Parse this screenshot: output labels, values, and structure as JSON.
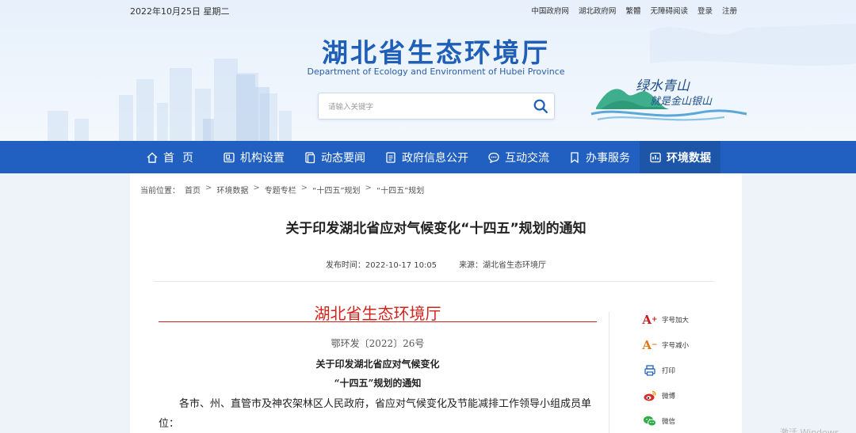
{
  "header": {
    "date": "2022年10月25日 星期二",
    "links": [
      "中国政府网",
      "湖北政府网",
      "繁體",
      "无障碍阅读",
      "登录",
      "注册"
    ],
    "site_title": "湖北省生态环境厅",
    "site_subtitle": "Department of Ecology and Environment of Hubei Province",
    "search_placeholder": "请输入关键字",
    "slogan_line1": "绿水青山",
    "slogan_line2": "就是金山银山"
  },
  "nav": {
    "items": [
      {
        "label": "首页",
        "icon": "home-icon"
      },
      {
        "label": "机构设置",
        "icon": "org-icon"
      },
      {
        "label": "动态要闻",
        "icon": "news-icon"
      },
      {
        "label": "政府信息公开",
        "icon": "document-icon"
      },
      {
        "label": "互动交流",
        "icon": "chat-icon"
      },
      {
        "label": "办事服务",
        "icon": "bookmark-icon"
      },
      {
        "label": "环境数据",
        "icon": "data-icon"
      }
    ],
    "active_index": 6
  },
  "breadcrumb": {
    "prefix": "当前位置：",
    "items": [
      "首页",
      "环境数据",
      "专题专栏",
      "“十四五”规划",
      "“十四五”规划"
    ],
    "separator": ">"
  },
  "article": {
    "title": "关于印发湖北省应对气候变化“十四五”规划的通知",
    "publish_time": "发布时间：2022-10-17 10:05",
    "source": "来源：湖北省生态环境厅"
  },
  "document": {
    "issuer": "湖北省生态环境厅",
    "number": "鄂环发〔2022〕26号",
    "title_line1": "关于印发湖北省应对气候变化",
    "title_line2": "“十四五”规划的通知",
    "body": "各市、州、直管市及神农架林区人民政府，省应对气候变化及节能减排工作领导小组成员单位："
  },
  "tools": {
    "font_increase": "字号加大",
    "font_decrease": "字号减小",
    "print": "打印",
    "weibo": "微博",
    "wechat": "微信"
  },
  "watermark": "激活 Windows",
  "colors": {
    "nav_bg": "#2160c0",
    "nav_active": "#1d55a8",
    "title_blue": "#1f5fb8",
    "doc_red": "#d2231b"
  }
}
